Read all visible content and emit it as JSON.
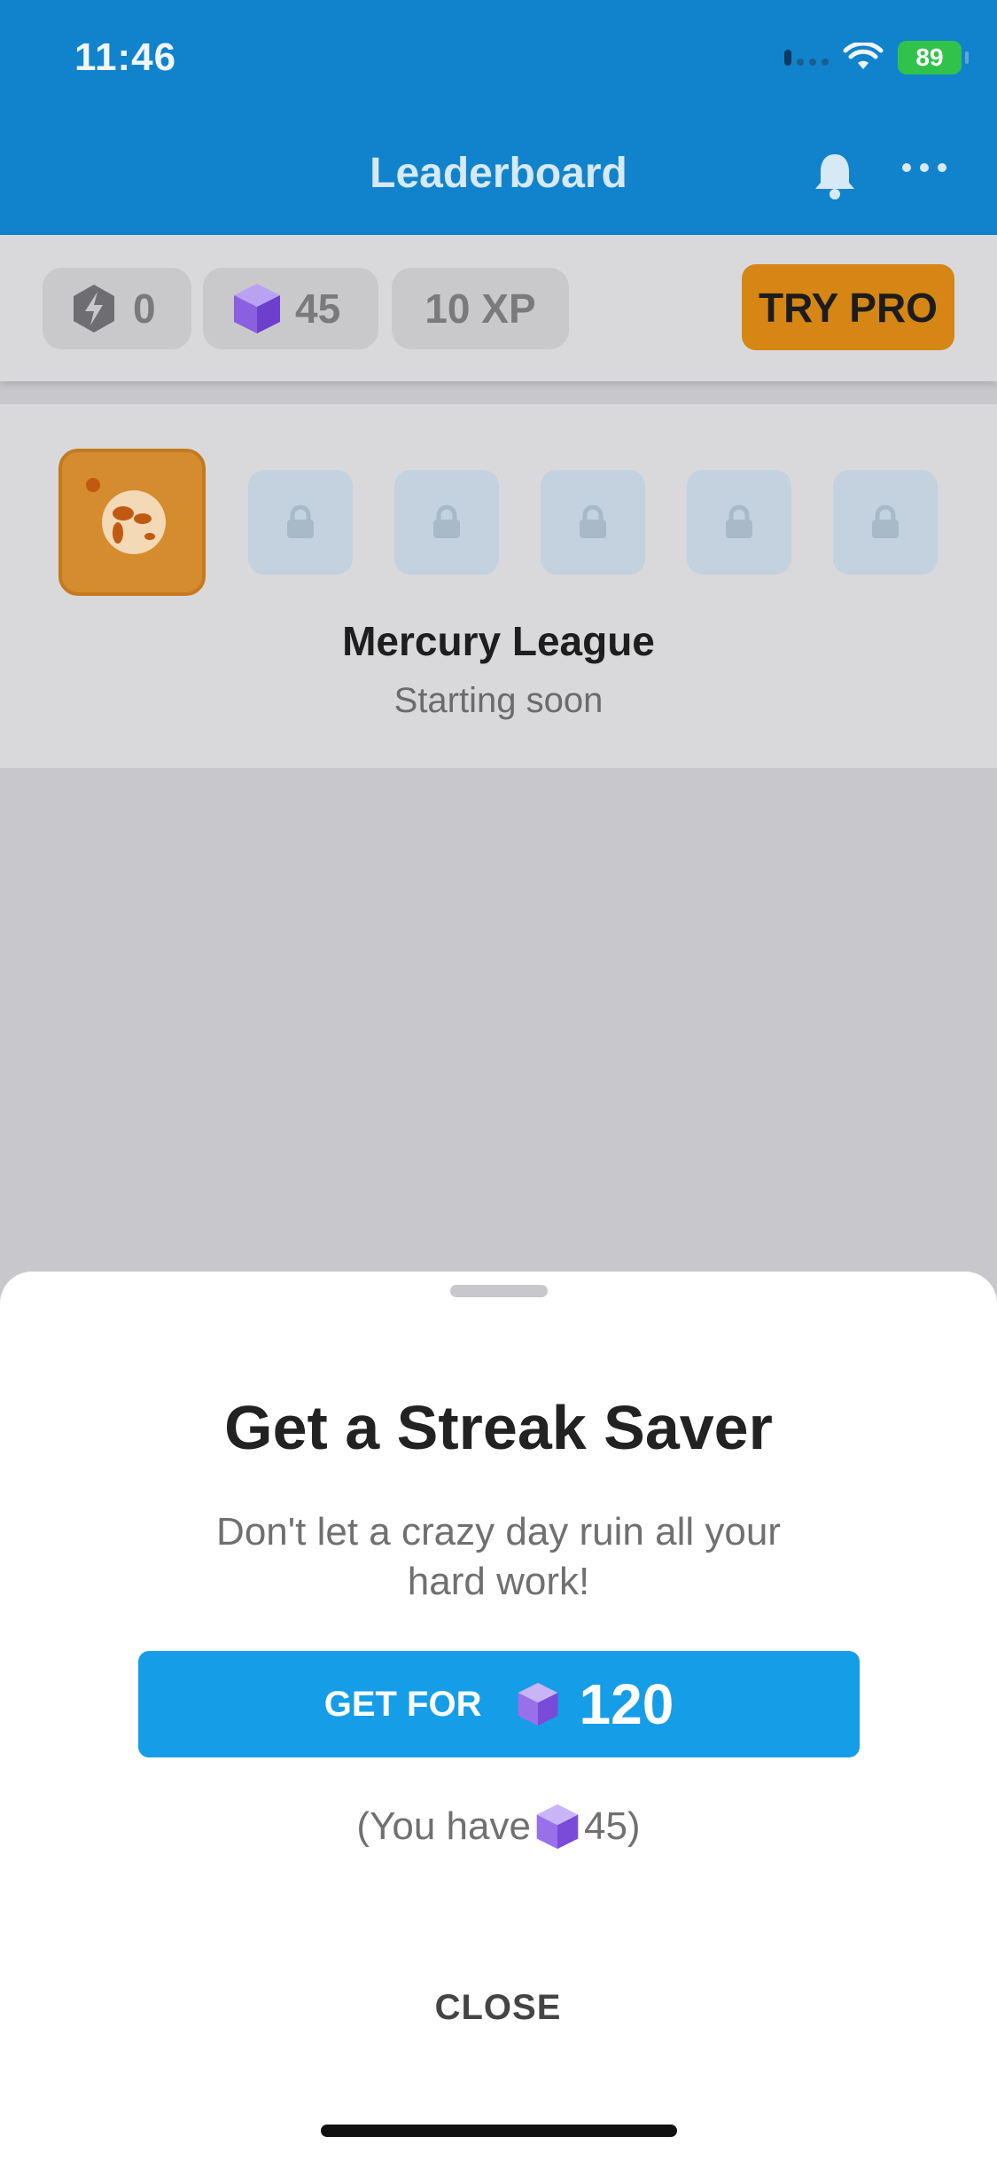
{
  "status_bar": {
    "time": "11:46",
    "battery": "89"
  },
  "header": {
    "title": "Leaderboard",
    "bell_icon": "bell-icon",
    "more_icon": "more-icon"
  },
  "stats": {
    "streak": "0",
    "gems": "45",
    "xp": "10 XP",
    "try_pro": "TRY PRO"
  },
  "league": {
    "name": "Mercury League",
    "status": "Starting soon",
    "locked_count": 5
  },
  "sheet": {
    "title": "Get a Streak Saver",
    "subtitle": "Don't let a crazy day ruin all your hard work!",
    "button_label": "GET FOR",
    "button_amount": "120",
    "you_have_prefix": "(You have",
    "you_have_amount": "45)",
    "close": "CLOSE"
  },
  "colors": {
    "header": "#1183cc",
    "pro": "#d68614",
    "primary": "#169de8",
    "gem": "#8a5fe0"
  }
}
